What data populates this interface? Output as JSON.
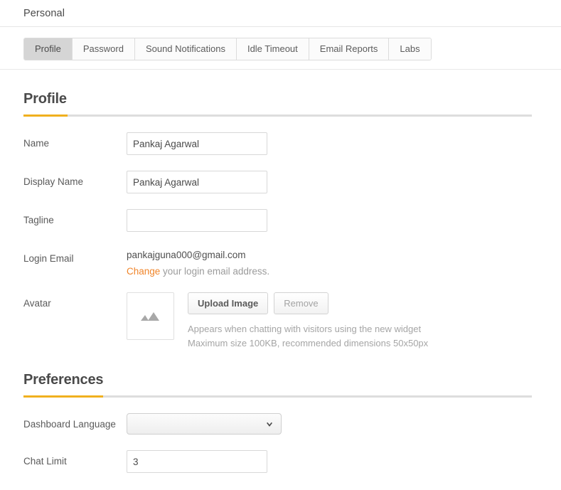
{
  "header": {
    "title": "Personal"
  },
  "tabs": [
    {
      "label": "Profile",
      "active": true
    },
    {
      "label": "Password",
      "active": false
    },
    {
      "label": "Sound Notifications",
      "active": false
    },
    {
      "label": "Idle Timeout",
      "active": false
    },
    {
      "label": "Email Reports",
      "active": false
    },
    {
      "label": "Labs",
      "active": false
    }
  ],
  "profile": {
    "section_title": "Profile",
    "name": {
      "label": "Name",
      "value": "Pankaj Agarwal",
      "placeholder": ""
    },
    "display_name": {
      "label": "Display Name",
      "value": "Pankaj Agarwal",
      "placeholder": ""
    },
    "tagline": {
      "label": "Tagline",
      "value": "",
      "placeholder": ""
    },
    "login_email": {
      "label": "Login Email",
      "value": "pankajguna000@gmail.com",
      "change_link": "Change",
      "help_suffix": " your login email address."
    },
    "avatar": {
      "label": "Avatar",
      "icon": "image-placeholder-icon",
      "upload_label": "Upload Image",
      "remove_label": "Remove",
      "note_line_1": "Appears when chatting with visitors using the new widget",
      "note_line_2": "Maximum size 100KB, recommended dimensions 50x50px"
    }
  },
  "preferences": {
    "section_title": "Preferences",
    "dashboard_language": {
      "label": "Dashboard Language",
      "value": "",
      "icon": "chevron-down-icon"
    },
    "chat_limit": {
      "label": "Chat Limit",
      "value": "3",
      "placeholder": ""
    }
  },
  "colors": {
    "accent": "#f0b01e",
    "link": "#f0852a",
    "text": "#4a4a4a",
    "muted": "#a5a5a5"
  }
}
